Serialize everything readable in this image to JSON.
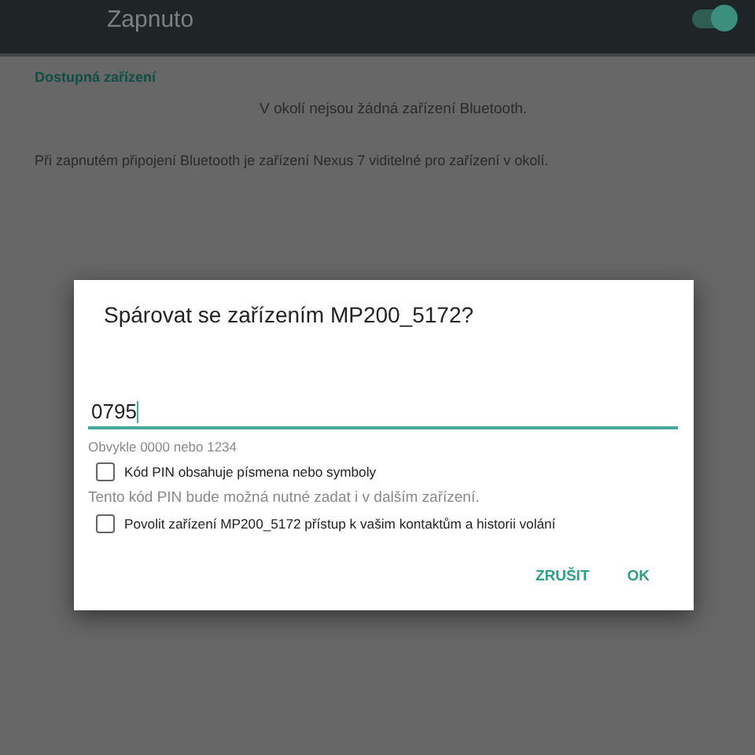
{
  "header": {
    "label": "Zapnuto",
    "toggle_on": true
  },
  "section_title": "Dostupná zařízení",
  "empty_message": "V okolí nejsou žádná zařízení Bluetooth.",
  "visibility_note": "Při zapnutém připojení Bluetooth je zařízení Nexus 7 viditelné pro zařízení v okolí.",
  "dialog": {
    "title": "Spárovat se zařízením MP200_5172?",
    "pin_value": "0795",
    "hint": "Obvykle 0000 nebo 1234",
    "options": [
      {
        "label": "Kód PIN obsahuje písmena nebo symboly",
        "checked": false
      },
      {
        "note": "Tento kód PIN bude možná nutné zadat i v dalším zařízení."
      },
      {
        "label": "Povolit zařízení MP200_5172 přístup k vašim kontaktům a historii volání",
        "checked": false
      }
    ],
    "buttons": [
      "ZRUŠIT",
      "OK"
    ]
  }
}
